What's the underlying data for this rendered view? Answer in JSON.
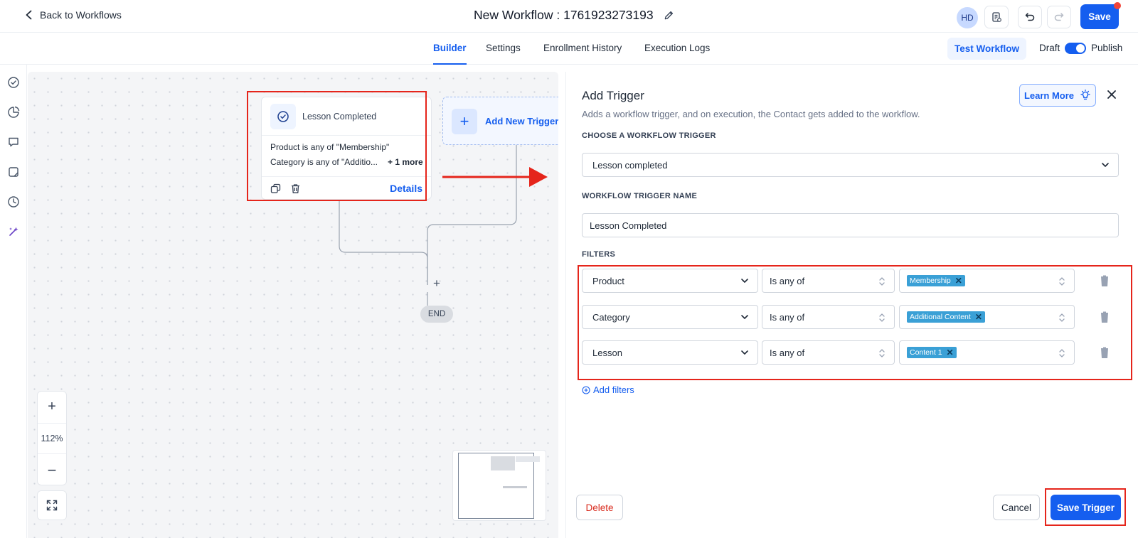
{
  "header": {
    "back_label": "Back to Workflows",
    "workflow_title": "New Workflow : 1761923273193",
    "avatar_initials": "HD",
    "save_label": "Save"
  },
  "tabs": [
    {
      "label": "Builder",
      "active": true
    },
    {
      "label": "Settings",
      "active": false
    },
    {
      "label": "Enrollment History",
      "active": false
    },
    {
      "label": "Execution Logs",
      "active": false
    }
  ],
  "toolbar": {
    "test_label": "Test Workflow",
    "draft_label": "Draft",
    "publish_label": "Publish",
    "publish_on": true
  },
  "rail_icons": [
    "check-circle-icon",
    "pie-chart-icon",
    "chat-icon",
    "note-icon",
    "history-icon",
    "sparkle-icon"
  ],
  "canvas": {
    "trigger_card": {
      "title": "Lesson Completed",
      "line1": "Product is any of \"Membership\"",
      "line2": "Category is any of \"Additio...",
      "more": "+ 1 more",
      "details_label": "Details"
    },
    "add_trigger_label": "Add New Trigger",
    "end_label": "END",
    "plus_label": "+",
    "zoom_level": "112%"
  },
  "panel": {
    "title": "Add Trigger",
    "subtitle": "Adds a workflow trigger, and on execution, the Contact gets added to the workflow.",
    "learn_more_label": "Learn More",
    "choose_label": "CHOOSE A WORKFLOW TRIGGER",
    "trigger_value": "Lesson completed",
    "name_label": "WORKFLOW TRIGGER NAME",
    "name_value": "Lesson Completed",
    "filters_label": "FILTERS",
    "filters": [
      {
        "field": "Product",
        "operator": "Is any of",
        "tag": "Membership"
      },
      {
        "field": "Category",
        "operator": "Is any of",
        "tag": "Additional Content"
      },
      {
        "field": "Lesson",
        "operator": "Is any of",
        "tag": "Content 1"
      }
    ],
    "add_filters_label": "Add filters",
    "delete_label": "Delete",
    "cancel_label": "Cancel",
    "save_trigger_label": "Save Trigger"
  },
  "colors": {
    "accent": "#155eef",
    "annotation_red": "#e5251b",
    "tag_blue": "#3aa0d6",
    "danger": "#d92d20"
  }
}
